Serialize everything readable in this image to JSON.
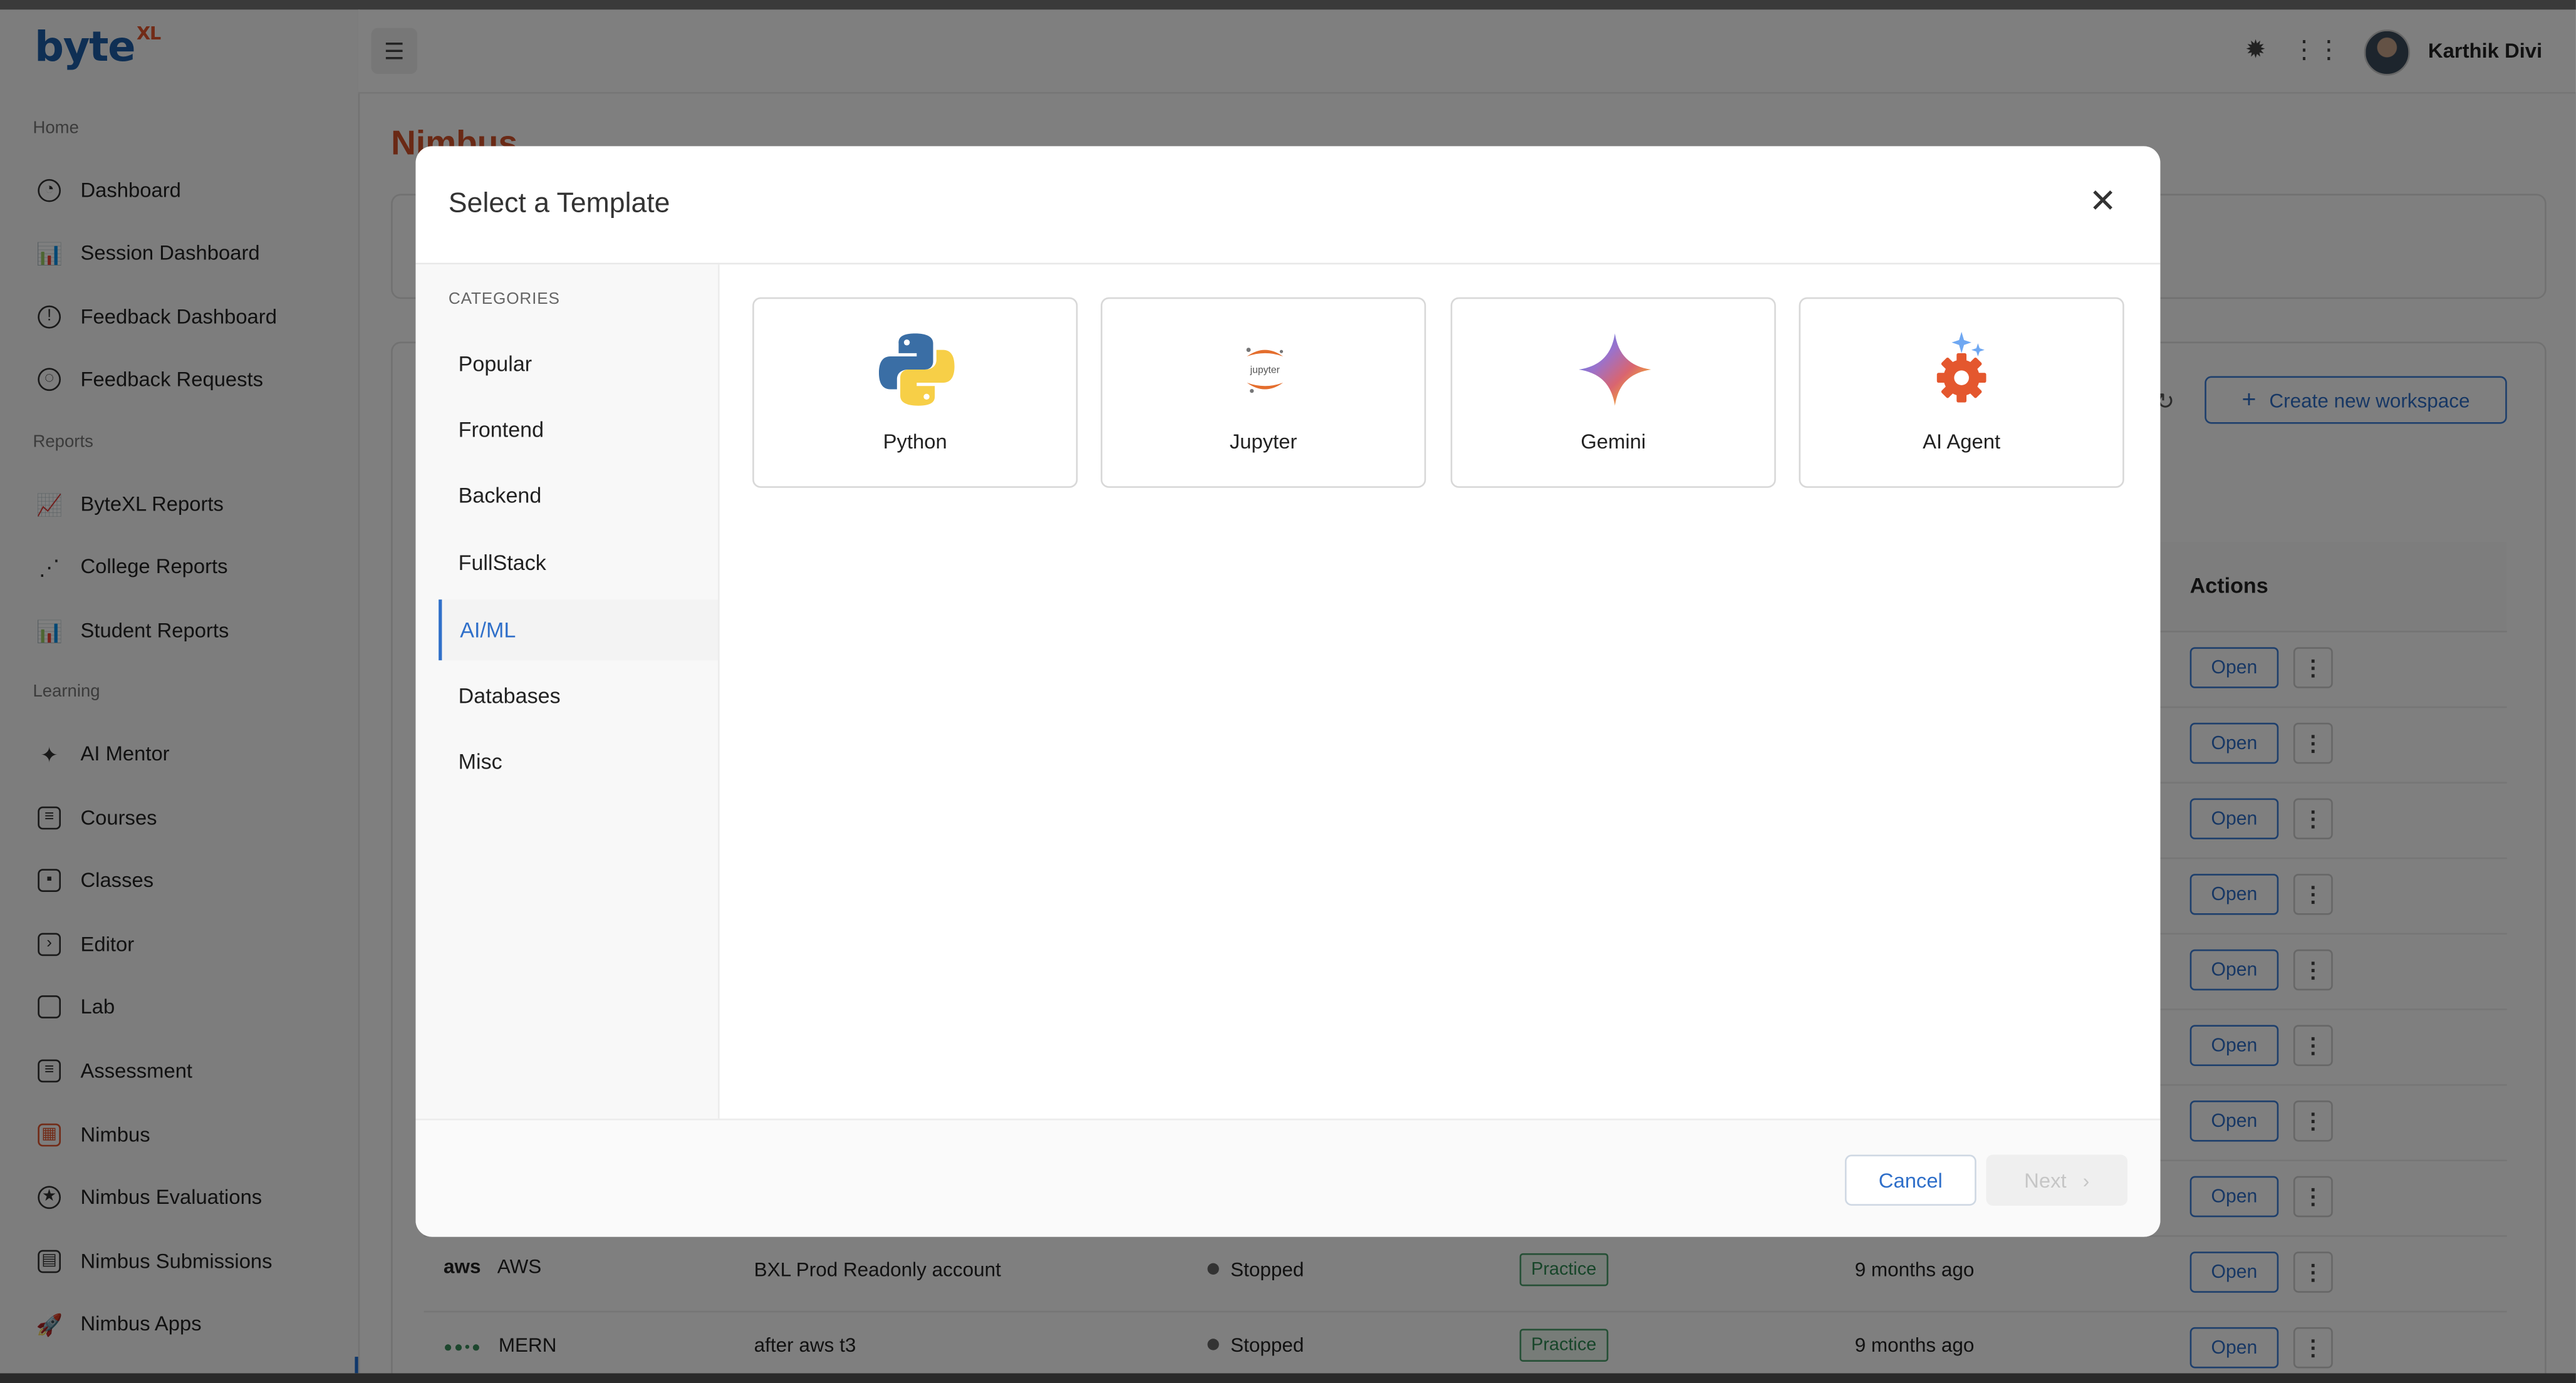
{
  "app": {
    "logo_text": "byte",
    "logo_sup": "XL",
    "user_name": "Karthik Divi",
    "page_title": "Nimbus"
  },
  "sidebar": {
    "sections": [
      {
        "label": "Home",
        "items": [
          {
            "label": "Dashboard",
            "icon": "dashboard-icon"
          },
          {
            "label": "Session Dashboard",
            "icon": "bar-chart-icon"
          },
          {
            "label": "Feedback Dashboard",
            "icon": "feedback-icon"
          },
          {
            "label": "Feedback Requests",
            "icon": "feedback-requests-icon"
          }
        ]
      },
      {
        "label": "Reports",
        "items": [
          {
            "label": "ByteXL Reports",
            "icon": "area-chart-icon"
          },
          {
            "label": "College Reports",
            "icon": "scatter-chart-icon"
          },
          {
            "label": "Student Reports",
            "icon": "bar-chart-icon"
          }
        ]
      },
      {
        "label": "Learning",
        "items": [
          {
            "label": "AI Mentor",
            "icon": "sparkle-icon"
          },
          {
            "label": "Courses",
            "icon": "book-icon"
          },
          {
            "label": "Classes",
            "icon": "classroom-icon"
          },
          {
            "label": "Editor",
            "icon": "terminal-icon"
          },
          {
            "label": "Lab",
            "icon": "laptop-icon"
          },
          {
            "label": "Assessment",
            "icon": "list-icon"
          },
          {
            "label": "Nimbus",
            "icon": "nimbus-icon"
          },
          {
            "label": "Nimbus Evaluations",
            "icon": "badge-icon"
          },
          {
            "label": "Nimbus Submissions",
            "icon": "calendar-icon"
          },
          {
            "label": "Nimbus Apps",
            "icon": "rocket-icon"
          }
        ]
      }
    ]
  },
  "toolbar": {
    "create_label": "Create new workspace",
    "create_plus": "+",
    "refresh_glyph": "↻"
  },
  "table": {
    "actions_header": "Actions",
    "open_label": "Open",
    "more_glyph": "⋮",
    "rows": [
      {
        "name": "",
        "description": "",
        "status": "",
        "type": "",
        "created": ""
      },
      {
        "name": "",
        "description": "",
        "status": "",
        "type": "",
        "created": ""
      },
      {
        "name": "",
        "description": "",
        "status": "",
        "type": "",
        "created": ""
      },
      {
        "name": "",
        "description": "",
        "status": "",
        "type": "",
        "created": ""
      },
      {
        "name": "",
        "description": "",
        "status": "",
        "type": "",
        "created": ""
      },
      {
        "name": "",
        "description": "",
        "status": "",
        "type": "",
        "created": ""
      },
      {
        "name": "",
        "description": "",
        "status": "",
        "type": "",
        "created": ""
      },
      {
        "name": "",
        "description": "",
        "status": "",
        "type": "",
        "created": ""
      },
      {
        "name": "AWS",
        "logo": "aws",
        "description": "BXL Prod Readonly account",
        "status": "Stopped",
        "type": "Practice",
        "created": "9 months ago"
      },
      {
        "name": "MERN",
        "logo": "mern",
        "description": "after aws t3",
        "status": "Stopped",
        "type": "Practice",
        "created": "9 months ago"
      }
    ]
  },
  "modal": {
    "title": "Select a Template",
    "close_glyph": "✕",
    "categories_label": "CATEGORIES",
    "categories": [
      "Popular",
      "Frontend",
      "Backend",
      "FullStack",
      "AI/ML",
      "Databases",
      "Misc"
    ],
    "active_category": "AI/ML",
    "templates": [
      {
        "name": "Python",
        "icon": "python-icon"
      },
      {
        "name": "Jupyter",
        "icon": "jupyter-icon",
        "icon_text": "jupyter"
      },
      {
        "name": "Gemini",
        "icon": "gemini-icon"
      },
      {
        "name": "AI Agent",
        "icon": "ai-agent-icon"
      }
    ],
    "cancel_label": "Cancel",
    "next_label": "Next",
    "next_glyph": "›"
  },
  "colors": {
    "brand_blue": "#1f5ea8",
    "brand_orange": "#e4572e",
    "accent": "#2f6fc9",
    "practice_green": "#2e8a53"
  }
}
